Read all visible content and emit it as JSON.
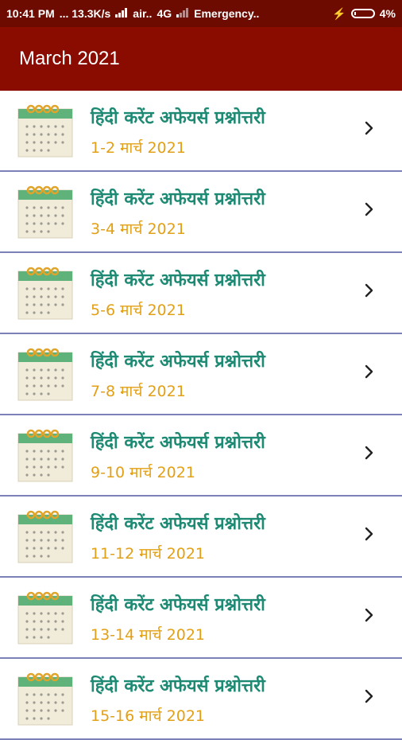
{
  "status_bar": {
    "time": "10:41 PM",
    "speed": "... 13.3K/s",
    "carrier": "air..",
    "network": "4G",
    "emergency": "Emergency..",
    "battery": "4%"
  },
  "app_bar": {
    "title": "March 2021"
  },
  "list": {
    "items": [
      {
        "title": "हिंदी करेंट अफेयर्स प्रश्नोत्तरी",
        "subtitle": "1-2 मार्च 2021",
        "icon": "calendar-icon"
      },
      {
        "title": "हिंदी करेंट अफेयर्स प्रश्नोत्तरी",
        "subtitle": "3-4 मार्च 2021",
        "icon": "calendar-icon"
      },
      {
        "title": "हिंदी करेंट अफेयर्स प्रश्नोत्तरी",
        "subtitle": "5-6 मार्च 2021",
        "icon": "calendar-icon"
      },
      {
        "title": "हिंदी करेंट अफेयर्स प्रश्नोत्तरी",
        "subtitle": "7-8 मार्च 2021",
        "icon": "calendar-icon"
      },
      {
        "title": "हिंदी करेंट अफेयर्स प्रश्नोत्तरी",
        "subtitle": "9-10 मार्च 2021",
        "icon": "calendar-icon"
      },
      {
        "title": "हिंदी करेंट अफेयर्स प्रश्नोत्तरी",
        "subtitle": "11-12 मार्च 2021",
        "icon": "calendar-icon"
      },
      {
        "title": "हिंदी करेंट अफेयर्स प्रश्नोत्तरी",
        "subtitle": "13-14 मार्च 2021",
        "icon": "calendar-icon"
      },
      {
        "title": "हिंदी करेंट अफेयर्स प्रश्नोत्तरी",
        "subtitle": "15-16 मार्च 2021",
        "icon": "calendar-icon"
      }
    ]
  },
  "colors": {
    "status_bar_bg": "#6e0b00",
    "app_bar_bg": "#8a0c00",
    "title_green": "#1e8a74",
    "subtitle_orange": "#e2a017",
    "divider": "#7b80b8"
  }
}
